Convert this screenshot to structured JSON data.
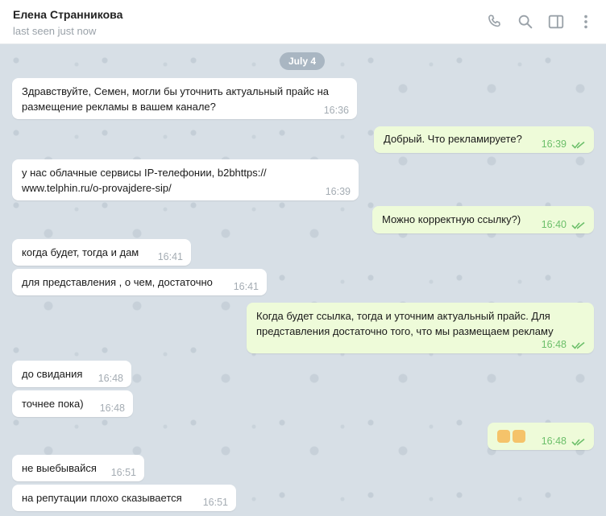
{
  "header": {
    "contact_name": "Елена Странникова",
    "status": "last seen just now",
    "icons": [
      "phone-icon",
      "search-icon",
      "sidebar-toggle-icon",
      "more-vertical-icon"
    ]
  },
  "chat": {
    "date_label": "July 4",
    "messages": [
      {
        "dir": "in",
        "text": "Здравствуйте, Семен, могли бы уточнить актуальный прайс на\nразмещение рекламы в вашем канале?",
        "time": "16:36"
      },
      {
        "dir": "out",
        "text": "Добрый. Что рекламируете?",
        "time": "16:39"
      },
      {
        "dir": "in",
        "text": "у нас облачные сервисы IP-телефонии, b2bhttps://\nwww.telphin.ru/o-provajdere-sip/",
        "time": "16:39"
      },
      {
        "dir": "out",
        "text": "Можно корректную ссылку?)",
        "time": "16:40"
      },
      {
        "dir": "in",
        "text": "когда будет, тогда и дам",
        "time": "16:41"
      },
      {
        "dir": "in",
        "text": "для представления , о чем, достаточно",
        "time": "16:41"
      },
      {
        "dir": "out",
        "text": "Когда будет ссылка, тогда и уточним актуальный прайс. Для\nпредставления достаточно того, что мы размещаем рекламу",
        "time": "16:48"
      },
      {
        "dir": "in",
        "text": "до свидания",
        "time": "16:48"
      },
      {
        "dir": "in",
        "text": "точнее пока)",
        "time": "16:48"
      },
      {
        "dir": "out",
        "text": "",
        "emoji": [
          "hand-pointing-icon",
          "raised-hand-icon"
        ],
        "time": "16:48"
      },
      {
        "dir": "in",
        "text": "не выебывайся",
        "time": "16:51"
      },
      {
        "dir": "in",
        "text": "на репутации плохо сказывается",
        "time": "16:51"
      }
    ]
  },
  "colors": {
    "incoming_bubble": "#ffffff",
    "outgoing_bubble": "#eefbd9",
    "read_check": "#6cbf6a",
    "chat_background": "#d7dfe6",
    "date_pill": "#a9b6c2"
  }
}
